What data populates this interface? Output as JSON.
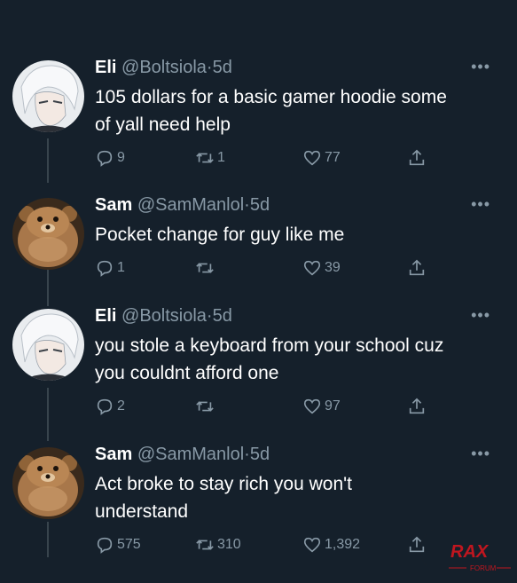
{
  "colors": {
    "background": "#15202b",
    "text": "#ffffff",
    "muted": "#8899a6",
    "watermark": "#c0161f"
  },
  "tweets": [
    {
      "name": "Eli",
      "handle": "@Boltsiola",
      "dot": "·",
      "time": "5d",
      "more": "•••",
      "lines": [
        "105 dollars for a basic gamer hoodie some",
        "of yall need help"
      ],
      "replies": "9",
      "retweets": "1",
      "likes": "77",
      "avatar": "anime-avatar-icon"
    },
    {
      "name": "Sam",
      "handle": "@SamManlol",
      "dot": "·",
      "time": "5d",
      "more": "•••",
      "lines": [
        "Pocket change for guy like me"
      ],
      "replies": "1",
      "retweets": "",
      "likes": "39",
      "avatar": "bear-avatar-icon"
    },
    {
      "name": "Eli",
      "handle": "@Boltsiola",
      "dot": "·",
      "time": "5d",
      "more": "•••",
      "lines": [
        "you stole a keyboard from your school cuz",
        "you couldnt afford one"
      ],
      "replies": "2",
      "retweets": "",
      "likes": "97",
      "avatar": "anime-avatar-icon"
    },
    {
      "name": "Sam",
      "handle": "@SamManlol",
      "dot": "·",
      "time": "5d",
      "more": "•••",
      "lines": [
        "Act broke to stay rich you won't",
        "understand"
      ],
      "replies": "575",
      "retweets": "310",
      "likes": "1,392",
      "avatar": "bear-avatar-icon"
    }
  ],
  "watermark": {
    "main": "RAX",
    "sub": "FORUM"
  }
}
